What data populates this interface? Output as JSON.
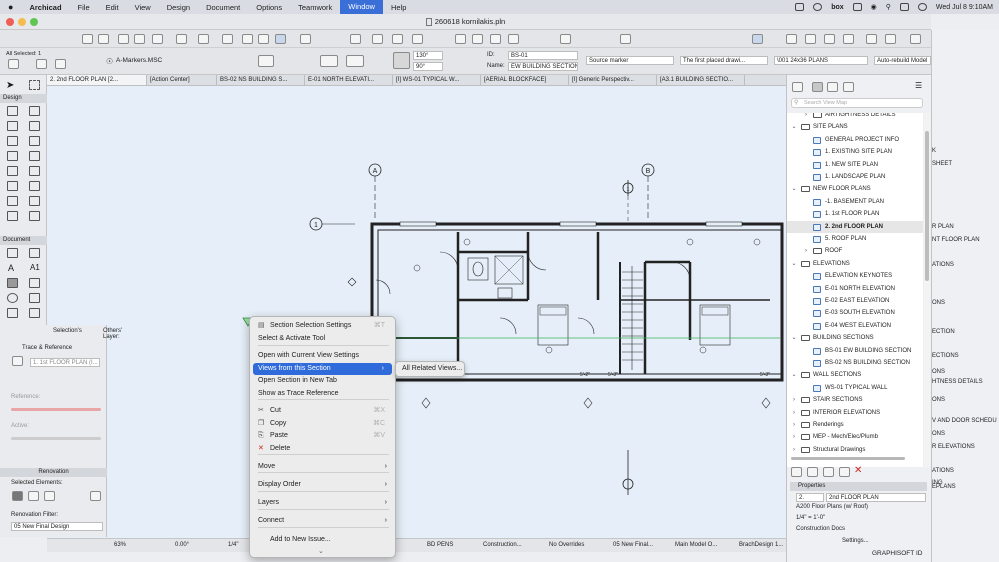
{
  "menubar": {
    "app": "Archicad",
    "items": [
      "File",
      "Edit",
      "View",
      "Design",
      "Document",
      "Options",
      "Teamwork",
      "Window",
      "Help"
    ],
    "active": "Window",
    "right": {
      "box": "box",
      "datetime": "Wed Jul 8  9:10AM"
    }
  },
  "window": {
    "title": "260618 kornilakis.pln"
  },
  "infobox": {
    "all_selected": "All Selected: 1",
    "layer": "A-Markers.MSC",
    "angle1": "130°",
    "angle2": "90°",
    "id_label": "ID:",
    "id_value": "BS-01",
    "name_label": "Name:",
    "name_value": "EW BUILDING SECTION",
    "marker": "Source marker",
    "placed": "The first placed drawi...",
    "sheet": "\\001 24x36 PLANS",
    "rebuild": "Auto-rebuild Model"
  },
  "tabs": [
    "2. 2nd FLOOR PLAN [2...",
    "[Action Center]",
    "BS-02 NS BUILDING S...",
    "E-01 NORTH ELEVATI...",
    "[I] WS-01 TYPICAL W...",
    "[AERIAL BLOCKFACE]",
    "[I] Generic Perspectiv...",
    "[A3.1 BUILDING SECTIO..."
  ],
  "toolbox": {
    "design": "Design",
    "document": "Document"
  },
  "trace": {
    "selections": "Selection's",
    "others_layer": "Others' Layer:",
    "title": "Trace & Reference",
    "ref_file": "1. 1st FLOOR PLAN (I...",
    "reference": "Reference:",
    "active": "Active:",
    "renovation": "Renovation",
    "selected_elements": "Selected Elements:",
    "filter_label": "Renovation Filter:",
    "filter_value": "05 New Final Design"
  },
  "drawing": {
    "grid_a": "A",
    "grid_b": "B",
    "grid_1": "1",
    "marker_1": "1",
    "dims": [
      "5'-2\"",
      "5'-2\"",
      "5'-3\"",
      "5'-3\""
    ]
  },
  "context_menu": {
    "items": [
      {
        "label": "Section Selection Settings",
        "shortcut": "⌘T"
      },
      {
        "label": "Select & Activate Tool"
      },
      {
        "label": "Open with Current View Settings"
      },
      {
        "label": "Views from this Section",
        "submenu": true,
        "highlighted": true
      },
      {
        "label": "Open Section in New Tab"
      },
      {
        "label": "Show as Trace Reference"
      },
      {
        "label": "Cut",
        "shortcut": "⌘X"
      },
      {
        "label": "Copy",
        "shortcut": "⌘C"
      },
      {
        "label": "Paste",
        "shortcut": "⌘V"
      },
      {
        "label": "Delete"
      },
      {
        "label": "Move",
        "submenu": true
      },
      {
        "label": "Display Order",
        "submenu": true
      },
      {
        "label": "Layers",
        "submenu": true
      },
      {
        "label": "Connect",
        "submenu": true
      },
      {
        "label": "Add to New Issue..."
      }
    ],
    "submenu_item": "All Related Views..."
  },
  "navigator": {
    "search_placeholder": "Search View Map",
    "rows": [
      {
        "label": "AIRTIGHTNESS DETAILS",
        "level": 1,
        "type": "folder",
        "chev": "›"
      },
      {
        "label": "SITE PLANS",
        "level": 0,
        "type": "folder",
        "chev": "⌄"
      },
      {
        "label": "GENERAL PROJECT INFO",
        "level": 1,
        "type": "view"
      },
      {
        "label": "1. EXISTING SITE PLAN",
        "level": 1,
        "type": "view"
      },
      {
        "label": "1. NEW SITE PLAN",
        "level": 1,
        "type": "view"
      },
      {
        "label": "1. LANDSCAPE PLAN",
        "level": 1,
        "type": "view"
      },
      {
        "label": "NEW FLOOR PLANS",
        "level": 0,
        "type": "folder",
        "chev": "⌄"
      },
      {
        "label": "-1. BASEMENT PLAN",
        "level": 1,
        "type": "view"
      },
      {
        "label": "1. 1st FLOOR PLAN",
        "level": 1,
        "type": "view"
      },
      {
        "label": "2. 2nd FLOOR PLAN",
        "level": 1,
        "type": "view",
        "selected": true
      },
      {
        "label": "5. ROOF PLAN",
        "level": 1,
        "type": "view"
      },
      {
        "label": "ROOF",
        "level": 1,
        "type": "folder",
        "chev": "›"
      },
      {
        "label": "ELEVATIONS",
        "level": 0,
        "type": "folder",
        "chev": "⌄"
      },
      {
        "label": "ELEVATION KEYNOTES",
        "level": 1,
        "type": "view"
      },
      {
        "label": "E-01 NORTH ELEVATION",
        "level": 1,
        "type": "view"
      },
      {
        "label": "E-02 EAST ELEVATION",
        "level": 1,
        "type": "view"
      },
      {
        "label": "E-03 SOUTH ELEVATION",
        "level": 1,
        "type": "view"
      },
      {
        "label": "E-04 WEST ELEVATION",
        "level": 1,
        "type": "view"
      },
      {
        "label": "BUILDING SECTIONS",
        "level": 0,
        "type": "folder",
        "chev": "⌄"
      },
      {
        "label": "BS-01 EW BUILDING SECTION",
        "level": 1,
        "type": "view"
      },
      {
        "label": "BS-02 NS BUILDING SECTION",
        "level": 1,
        "type": "view"
      },
      {
        "label": "WALL SECTIONS",
        "level": 0,
        "type": "folder",
        "chev": "⌄"
      },
      {
        "label": "WS-01 TYPICAL WALL",
        "level": 1,
        "type": "view"
      },
      {
        "label": "STAIR SECTIONS",
        "level": 0,
        "type": "folder",
        "chev": "›"
      },
      {
        "label": "INTERIOR ELEVATIONS",
        "level": 0,
        "type": "folder",
        "chev": "›"
      },
      {
        "label": "Renderings",
        "level": 0,
        "type": "folder",
        "chev": "›"
      },
      {
        "label": "MEP - Mech/Elec/Plumb",
        "level": 0,
        "type": "folder",
        "chev": "›"
      },
      {
        "label": "Structural Drawings",
        "level": 0,
        "type": "folder",
        "chev": "›"
      }
    ]
  },
  "properties": {
    "title": "Properties",
    "num": "2.",
    "name": "2nd FLOOR PLAN",
    "combo": "A200 Floor Plans (w/ Roof)",
    "scale": "1/4\"   =   1'-0\"",
    "docs": "Construction Docs",
    "settings": "Settings...",
    "brand": "GRAPHISOFT ID"
  },
  "right_strip": [
    "K",
    "SHEET",
    "R PLAN",
    "NT FLOOR PLAN",
    "ATIONS",
    "ONS",
    "ECTION",
    "ECTIONS",
    "ONS",
    "HTNESS DETAILS",
    "ONS",
    "V AND DOOR SCHEDU",
    "ONS",
    "R ELEVATIONS",
    "ATIONS",
    "ING",
    "EPLANS"
  ],
  "statusbar": {
    "zoom": "63%",
    "angle": "0.00°",
    "scale": "1/4\"",
    "pens": "BD PENS",
    "construction": "Construction...",
    "overrides": "No Overrides",
    "renovation": "05 New Final...",
    "model": "Main Model O...",
    "design": "BrachDesign 1..."
  }
}
